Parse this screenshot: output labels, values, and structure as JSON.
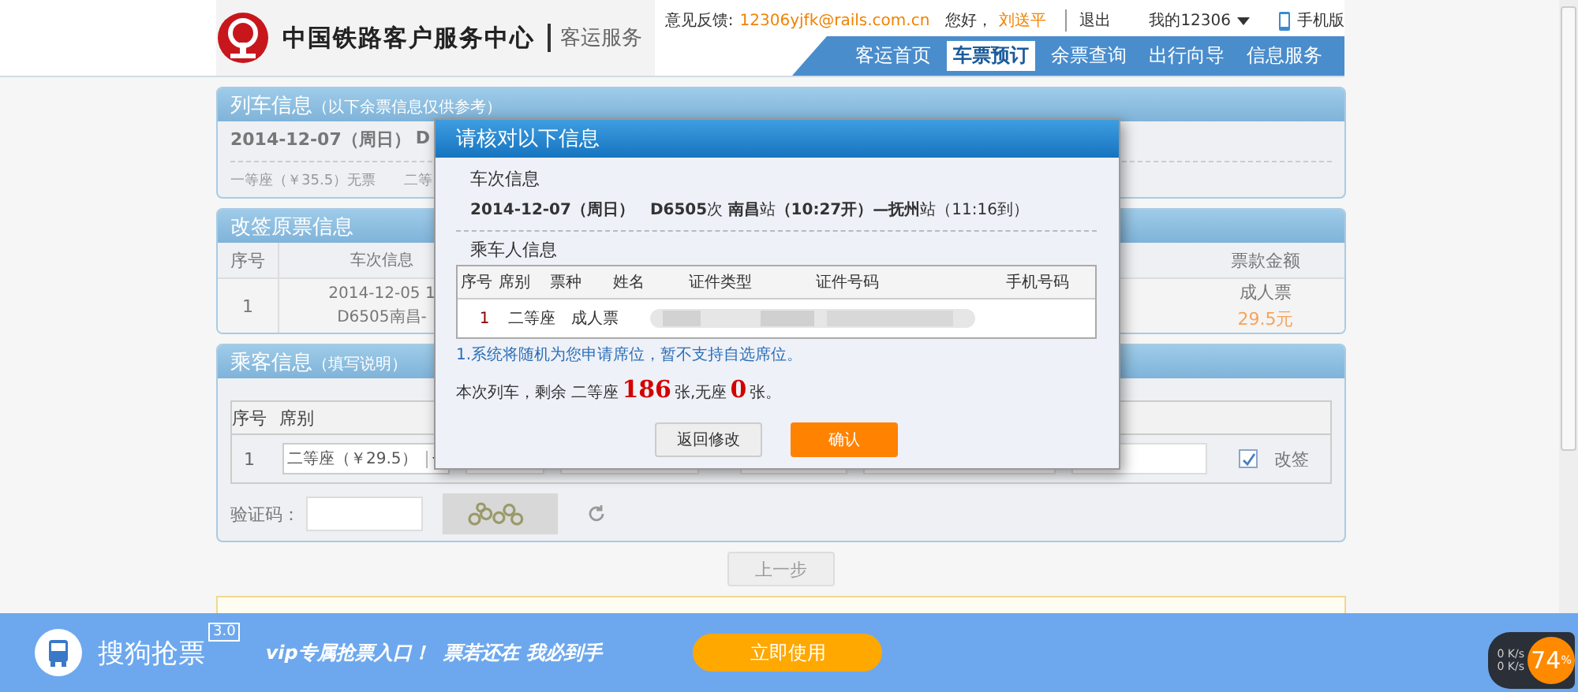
{
  "header": {
    "logo_text": "中国铁路客户服务中心",
    "service": "客运服务",
    "feedback_label": "意见反馈:",
    "feedback_email": "12306yjfk@rails.com.cn",
    "greeting": "您好，",
    "user": "刘送平",
    "logout": "退出",
    "my_account": "我的12306",
    "mobile": "手机版"
  },
  "nav": [
    {
      "label": "客运首页",
      "selected": false
    },
    {
      "label": "车票预订",
      "selected": true
    },
    {
      "label": "余票查询",
      "selected": false
    },
    {
      "label": "出行向导",
      "selected": false
    },
    {
      "label": "信息服务",
      "selected": false
    }
  ],
  "train_info": {
    "title": "列车信息",
    "note": "（以下余票信息仅供参考）",
    "date": "2014-12-07（周日）",
    "train_partial": "D",
    "seats": [
      "一等座（￥35.5）无票",
      "二等"
    ]
  },
  "original_ticket": {
    "title": "改签原票信息",
    "columns": [
      "序号",
      "车次信息",
      "票款金额"
    ],
    "row": {
      "index": "1",
      "train_line1": "2014-12-05 1",
      "train_line2": "D6505南昌-",
      "ticket_type": "成人票",
      "price": "29.5元"
    }
  },
  "passengers": {
    "title": "乘客信息",
    "note": "（填写说明）",
    "columns": [
      "序号",
      "席别"
    ],
    "rows": [
      {
        "index": "1",
        "seat": "二等座（￥29.5）",
        "change_checked": true,
        "change_label": "改签"
      }
    ],
    "captcha_label": "验证码：",
    "back_button": "上一步"
  },
  "dialog": {
    "title": "请核对以下信息",
    "train_section": "车次信息",
    "train_line": "**2014-12-07（周日）　D6505**次 **南昌**站**（10:27开）—抚州**站（11:16到）",
    "passenger_section": "乘车人信息",
    "columns": [
      "序号",
      "席别",
      "票种",
      "姓名",
      "证件类型",
      "证件号码",
      "手机号码"
    ],
    "rows": [
      {
        "index": "1",
        "seat": "二等座",
        "ticket_type": "成人票"
      }
    ],
    "notice": "1.系统将随机为您申请席位，暂不支持自选席位。",
    "remaining": [
      {
        "kind": "plain",
        "text": "本次列车，剩余 二等座"
      },
      {
        "kind": "count",
        "text": "186"
      },
      {
        "kind": "plain",
        "text": "张,无座"
      },
      {
        "kind": "count",
        "text": "0"
      },
      {
        "kind": "plain",
        "text": "张。"
      }
    ],
    "buttons": [
      {
        "kind": "secondary",
        "label": "返回修改"
      },
      {
        "kind": "primary",
        "label": "确认"
      }
    ]
  },
  "ad": {
    "brand": "搜狗抢票",
    "version": "3.0",
    "slogan": "vip专属抢票入口！  票若还在 我必到手",
    "button": "立即使用"
  },
  "speed_widget": {
    "upload": "0 K/s",
    "download": "0 K/s",
    "percent": "74",
    "unit": "%"
  }
}
